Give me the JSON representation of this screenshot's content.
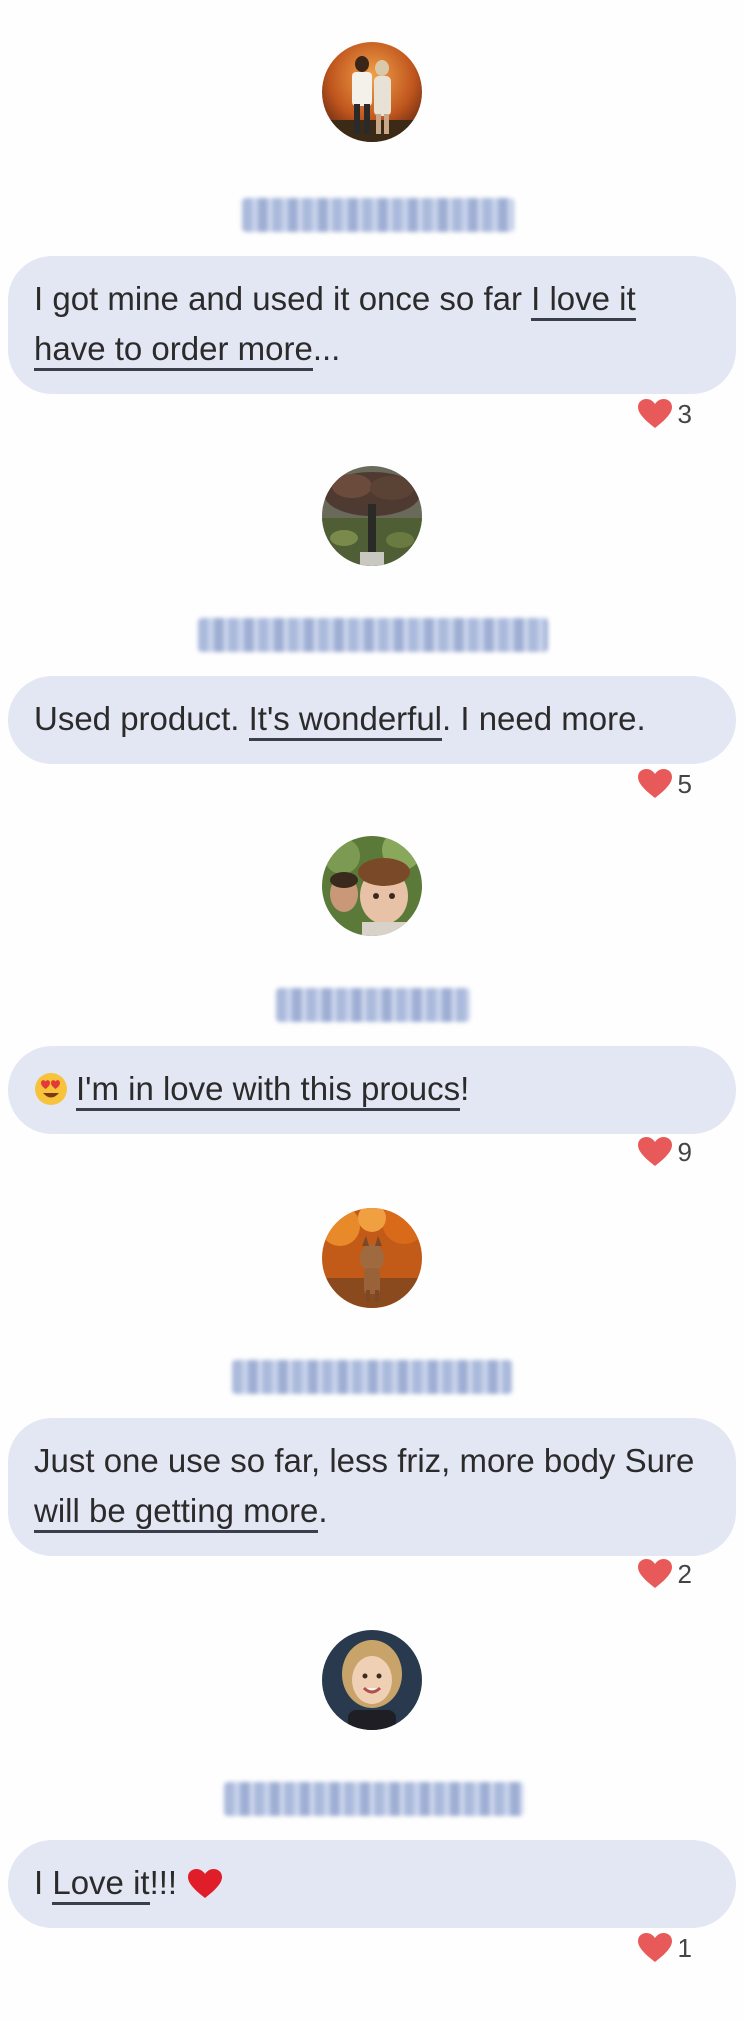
{
  "reviews": [
    {
      "avatar": "avatar-couple-sunset",
      "text_parts": [
        {
          "text": "I got mine and used it once so far ",
          "underline": false
        },
        {
          "text": "I love it have to order more",
          "underline": true
        },
        {
          "text": "...",
          "underline": false
        }
      ],
      "likes": "3"
    },
    {
      "avatar": "avatar-tree-landscape",
      "text_parts": [
        {
          "text": "Used product. ",
          "underline": false
        },
        {
          "text": "It's wonderful",
          "underline": true
        },
        {
          "text": ". I need more.",
          "underline": false
        }
      ],
      "likes": "5"
    },
    {
      "avatar": "avatar-children",
      "emoji": "heart-eyes-emoji",
      "text_parts": [
        {
          "text": "I'm in love with this proucs",
          "underline": true
        },
        {
          "text": "!",
          "underline": false
        }
      ],
      "likes": "9"
    },
    {
      "avatar": "avatar-dog-autumn",
      "text_parts": [
        {
          "text": "Just one use so far, less friz, more body Sure ",
          "underline": false
        },
        {
          "text": "will be getting more",
          "underline": true
        },
        {
          "text": ".",
          "underline": false
        }
      ],
      "likes": "2"
    },
    {
      "avatar": "avatar-smiling-woman",
      "text_parts": [
        {
          "text": "I ",
          "underline": false
        },
        {
          "text": "Love it",
          "underline": true
        },
        {
          "text": "!!! ",
          "underline": false
        }
      ],
      "trailing_emoji": "red-heart-emoji",
      "likes": "1"
    }
  ],
  "colors": {
    "bubble_bg": "#e3e6f3",
    "like_heart": "#e85a5a",
    "name_blur": "#8fa3d0"
  },
  "icons": {
    "like": "heart-icon"
  }
}
